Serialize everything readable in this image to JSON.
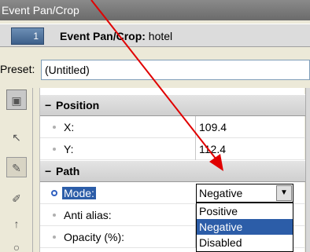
{
  "window": {
    "title": "Event Pan/Crop"
  },
  "header": {
    "badge": "1",
    "title_bold": "Event Pan/Crop:",
    "title_rest": " hotel"
  },
  "preset": {
    "label": "Preset:",
    "value": "(Untitled)"
  },
  "sections": [
    {
      "sign": "−",
      "title": "Position"
    },
    {
      "sign": "−",
      "title": "Path"
    }
  ],
  "position_rows": [
    {
      "name": "X:",
      "value": "109.4"
    },
    {
      "name": "Y:",
      "value": "112.4"
    }
  ],
  "path_rows": [
    {
      "name": "Mode:"
    },
    {
      "name": "Anti alias:"
    },
    {
      "name": "Opacity (%):"
    }
  ],
  "combo": {
    "value": "Negative",
    "button": "▼"
  },
  "dropdown": {
    "options": [
      "Positive",
      "Negative",
      "Disabled"
    ],
    "selected": "Negative"
  },
  "tools": [
    "select-icon",
    "arrow-icon",
    "pen-icon",
    "pen-add-icon",
    "pointer-icon",
    "ellipse-icon"
  ],
  "colors": {
    "annotation_arrow": "#e00000",
    "selection": "#2c5da8"
  }
}
